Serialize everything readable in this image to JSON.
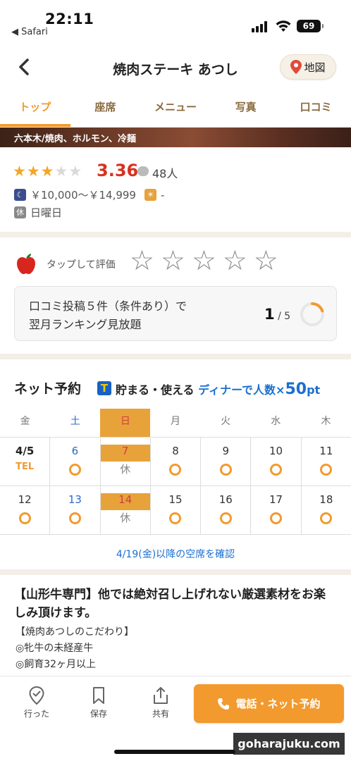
{
  "status_bar": {
    "time": "22:11",
    "back_app": "◀ Safari",
    "battery": "69"
  },
  "header": {
    "title": "焼肉ステーキ あつし",
    "map_label": "地図"
  },
  "tabs": [
    "トップ",
    "座席",
    "メニュー",
    "写真",
    "口コミ"
  ],
  "active_tab": 0,
  "hero": {
    "category": "六本木/焼肉、ホルモン、冷麺"
  },
  "rating": {
    "stars": 3,
    "max_stars": 5,
    "score": "3.36",
    "review_count": "48人"
  },
  "price": {
    "dinner": "￥10,000～￥14,999",
    "lunch": "-"
  },
  "holiday": {
    "badge": "休",
    "value": "日曜日"
  },
  "evaluate": {
    "tap_label": "タップして評価",
    "star_count": 5,
    "promo_line1": "口コミ投稿５件（条件あり）で",
    "promo_line2": "翌月ランキング見放題",
    "progress_current": "1",
    "progress_total": "/ 5",
    "progress_fraction": 0.2
  },
  "reservation": {
    "title": "ネット予約",
    "tpoint_icon": "T",
    "promo_prefix": "貯まる・使える",
    "promo_middle": "ディナーで人数×",
    "promo_points": "50",
    "promo_unit": "pt",
    "weekdays": [
      "金",
      "土",
      "日",
      "月",
      "火",
      "水",
      "木"
    ],
    "weeks": [
      [
        {
          "date": "4/5",
          "status": "TEL"
        },
        {
          "date": "6",
          "status": "○"
        },
        {
          "date": "7",
          "status": "休"
        },
        {
          "date": "8",
          "status": "○"
        },
        {
          "date": "9",
          "status": "○"
        },
        {
          "date": "10",
          "status": "○"
        },
        {
          "date": "11",
          "status": "○"
        }
      ],
      [
        {
          "date": "12",
          "status": "○"
        },
        {
          "date": "13",
          "status": "○"
        },
        {
          "date": "14",
          "status": "休"
        },
        {
          "date": "15",
          "status": "○"
        },
        {
          "date": "16",
          "status": "○"
        },
        {
          "date": "17",
          "status": "○"
        },
        {
          "date": "18",
          "status": "○"
        }
      ]
    ],
    "more_link": "4/19(金)以降の空席を確認"
  },
  "description": {
    "title": "【山形牛専門】他では絶対召し上げれない厳選素材をお楽しみ頂けます。",
    "lines": [
      "【焼肉あつしのこだわり】",
      "◎牝牛の未経産牛",
      "◎飼育32ヶ月以上"
    ]
  },
  "bottom_bar": {
    "went_label": "行った",
    "save_label": "保存",
    "share_label": "共有",
    "call_label": "電話・ネット予約"
  },
  "watermark": "goharajuku.com",
  "colors": {
    "accent": "#f29a2e",
    "rating_red": "#d8311f",
    "link_blue": "#1a6fd0"
  }
}
